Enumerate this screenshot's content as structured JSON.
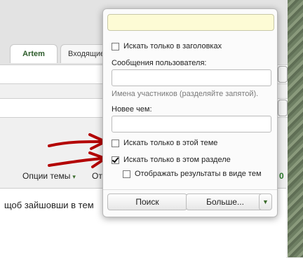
{
  "background": {
    "tabs": [
      {
        "label": "Artem"
      },
      {
        "label": "Входящие"
      }
    ],
    "thread_options": {
      "label": "Опции темы",
      "chevron": "▾"
    },
    "options_partial": "От",
    "count_partial": "0",
    "post_text": "щоб зайшовши в тем"
  },
  "popup": {
    "search_value": "",
    "titles_only": {
      "label": "Искать только в заголовках",
      "checked": false
    },
    "user_messages": {
      "label": "Сообщения пользователя:",
      "value": ""
    },
    "user_hint": "Имена участников (разделяйте запятой).",
    "newer_than": {
      "label": "Новее чем:",
      "value": ""
    },
    "this_thread": {
      "label": "Искать только в этой теме",
      "checked": false
    },
    "this_section": {
      "label": "Искать только в этом разделе",
      "checked": true
    },
    "show_as_threads": {
      "label": "Отображать результаты в виде тем",
      "checked": false
    },
    "buttons": {
      "search": "Поиск",
      "more": "Больше...",
      "dropdown_icon": "chevron-down"
    }
  },
  "colors": {
    "accent_green": "#3a6b2b",
    "arrow_red": "#b30000",
    "search_bg": "#fdfbd5"
  }
}
